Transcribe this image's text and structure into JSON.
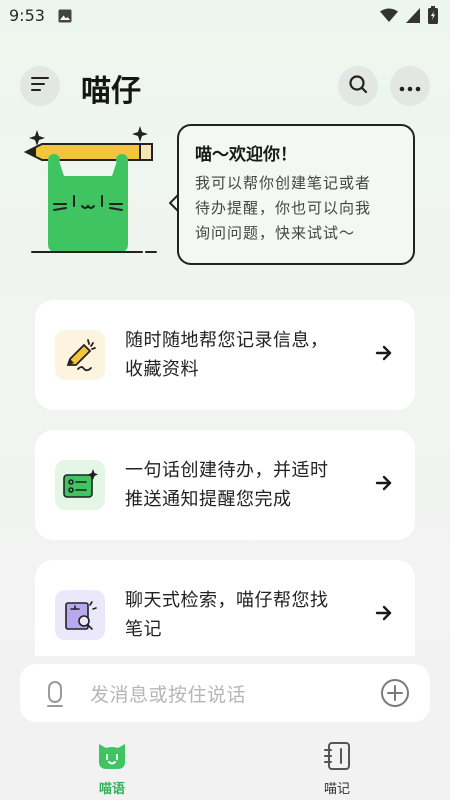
{
  "status_bar": {
    "time": "9:53",
    "icons": [
      "gallery-icon",
      "wifi-icon",
      "signal-icon",
      "battery-icon"
    ]
  },
  "header": {
    "title": "喵仔",
    "icons": [
      "menu-icon",
      "search-icon",
      "more-icon"
    ]
  },
  "hero": {
    "bubble_title": "喵～欢迎你！",
    "bubble_lines": [
      "我可以帮你创建笔记或者",
      "待办提醒，你也可以向我",
      "询问问题，快来试试～"
    ]
  },
  "features": [
    {
      "lines": [
        "随时随地帮您记录信息，",
        "收藏资料"
      ],
      "icon": "note-pencil-icon",
      "icon_bg": "#fdf4df"
    },
    {
      "lines": [
        "一句话创建待办，并适时",
        "推送通知提醒您完成"
      ],
      "icon": "todo-list-icon",
      "icon_bg": "#e4f7e6"
    },
    {
      "lines": [
        "聊天式检索，喵仔帮您找",
        "笔记"
      ],
      "icon": "search-note-icon",
      "icon_bg": "#ece8fb"
    }
  ],
  "input": {
    "placeholder": "发消息或按住说话"
  },
  "tabs": [
    {
      "label": "喵语",
      "icon": "cat-chat-icon",
      "active": true
    },
    {
      "label": "喵记",
      "icon": "notebook-icon",
      "active": false
    }
  ],
  "colors": {
    "accent": "#34b05a",
    "cat_green": "#3fc461",
    "pencil_yellow": "#f3c53c"
  }
}
